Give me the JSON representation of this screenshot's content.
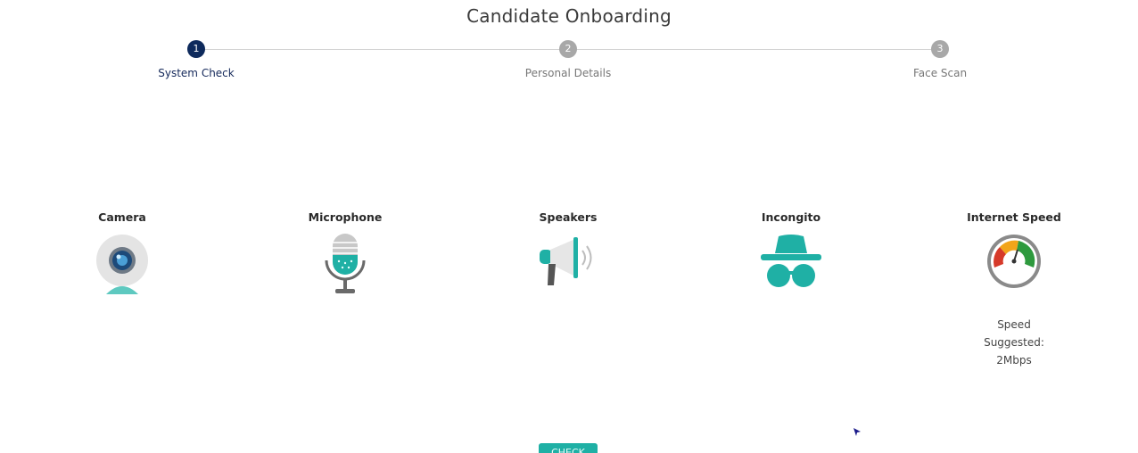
{
  "header": {
    "title": "Candidate Onboarding"
  },
  "stepper": {
    "steps": [
      {
        "number": "1",
        "label": "System Check",
        "active": true
      },
      {
        "number": "2",
        "label": "Personal Details",
        "active": false
      },
      {
        "number": "3",
        "label": "Face Scan",
        "active": false
      }
    ]
  },
  "checks": {
    "camera": {
      "label": "Camera",
      "icon": "webcam-icon"
    },
    "microphone": {
      "label": "Microphone",
      "icon": "microphone-icon"
    },
    "speakers": {
      "label": "Speakers",
      "icon": "megaphone-icon"
    },
    "incognito": {
      "label": "Incongito",
      "icon": "incognito-icon"
    },
    "internet": {
      "label": "Internet Speed",
      "icon": "speedometer-icon",
      "note_line1": "Speed",
      "note_line2": "Suggested:",
      "note_line3": "2Mbps"
    }
  },
  "actions": {
    "check_label": "CHECK"
  },
  "colors": {
    "accent": "#1fb0a5",
    "active_step": "#0e2a5c",
    "inactive_step": "#a8a8a8"
  }
}
